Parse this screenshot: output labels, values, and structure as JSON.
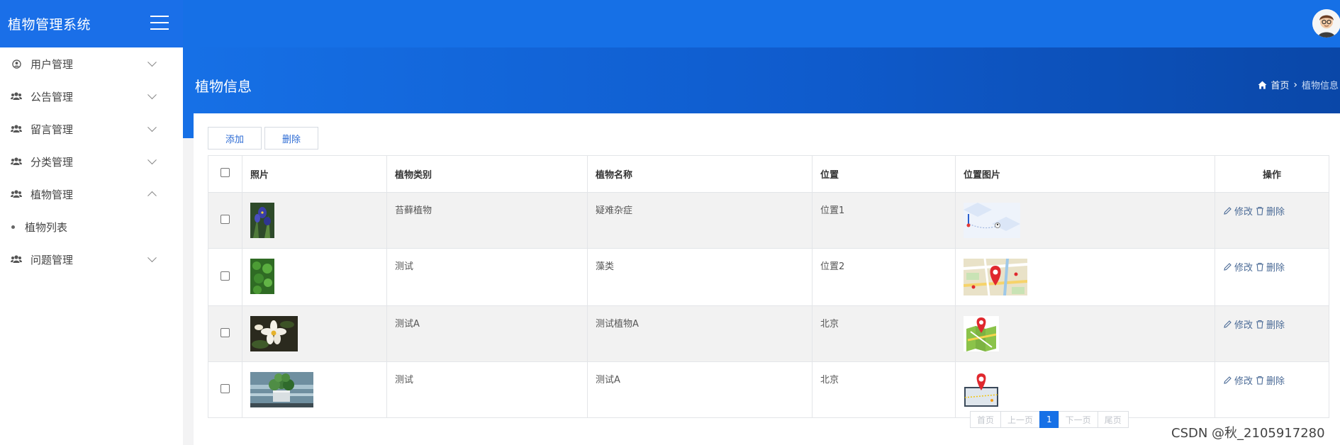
{
  "app": {
    "title": "植物管理系统"
  },
  "sidebar": {
    "items": [
      {
        "label": "用户管理",
        "icon": "user-circle-icon",
        "expanded": false
      },
      {
        "label": "公告管理",
        "icon": "users-icon",
        "expanded": false
      },
      {
        "label": "留言管理",
        "icon": "users-icon",
        "expanded": false
      },
      {
        "label": "分类管理",
        "icon": "users-icon",
        "expanded": false
      },
      {
        "label": "植物管理",
        "icon": "users-icon",
        "expanded": true,
        "children": [
          {
            "label": "植物列表"
          }
        ]
      },
      {
        "label": "问题管理",
        "icon": "users-icon",
        "expanded": false
      }
    ]
  },
  "header": {
    "page_title": "植物信息",
    "breadcrumb": {
      "home": "首页",
      "current": "植物信息"
    }
  },
  "toolbar": {
    "add_label": "添加",
    "delete_label": "删除"
  },
  "table": {
    "columns": [
      "照片",
      "植物类别",
      "植物名称",
      "位置",
      "位置图片",
      "操作"
    ],
    "rows": [
      {
        "photo": "plant-photo-iris",
        "category": "苔藓植物",
        "name": "疑难杂症",
        "location": "位置1",
        "location_image": "map-thumbnail-1"
      },
      {
        "photo": "plant-photo-leaves",
        "category": "测试",
        "name": "藻类",
        "location": "位置2",
        "location_image": "map-thumbnail-2"
      },
      {
        "photo": "plant-photo-flower",
        "category": "测试A",
        "name": "测试植物A",
        "location": "北京",
        "location_image": "map-thumbnail-3"
      },
      {
        "photo": "plant-photo-pot",
        "category": "测试",
        "name": "测试A",
        "location": "北京",
        "location_image": "map-thumbnail-4"
      }
    ],
    "row_actions": {
      "edit": "修改",
      "delete": "删除"
    }
  },
  "pagination": {
    "first": "首页",
    "prev": "上一页",
    "current": "1",
    "next": "下一页",
    "last": "尾页"
  },
  "watermark": "CSDN @秋_2105917280",
  "colors": {
    "primary": "#1670e6",
    "header_gradient_end": "#0a47a8"
  }
}
